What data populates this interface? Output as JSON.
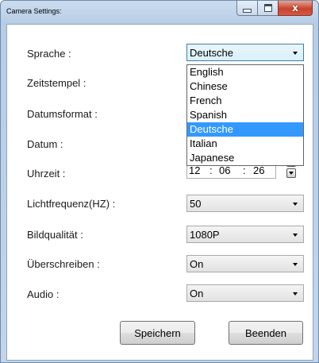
{
  "window": {
    "title": "Camera Settings:"
  },
  "fields": {
    "language": {
      "label": "Sprache :",
      "value": "Deutsche"
    },
    "timestamp": {
      "label": "Zeitstempel :"
    },
    "date_format": {
      "label": "Datumsformat :"
    },
    "date": {
      "label": "Datum :"
    },
    "time": {
      "label": "Uhrzeit :",
      "hour": "12",
      "minute": "06",
      "second": "26",
      "sep": ":"
    },
    "light_frequency": {
      "label": "Lichtfrequenz(HZ) :",
      "value": "50"
    },
    "image_quality": {
      "label": "Bildqualität :",
      "value": "1080P"
    },
    "overwrite": {
      "label": "Überschreiben :",
      "value": "On"
    },
    "audio": {
      "label": "Audio :",
      "value": "On"
    }
  },
  "language_options": [
    "English",
    "Chinese",
    "French",
    "Spanish",
    "Deutsche",
    "Italian",
    "Japanese"
  ],
  "buttons": {
    "save": "Speichern",
    "exit": "Beenden"
  },
  "caption": {
    "close_glyph": "x"
  },
  "colors": {
    "selection": "#3399ff",
    "frame": "#b7cde6"
  },
  "icons": [
    "minimize-icon",
    "maximize-icon",
    "close-icon",
    "spin-up-icon",
    "spin-down-icon",
    "chevron-down-icon"
  ]
}
